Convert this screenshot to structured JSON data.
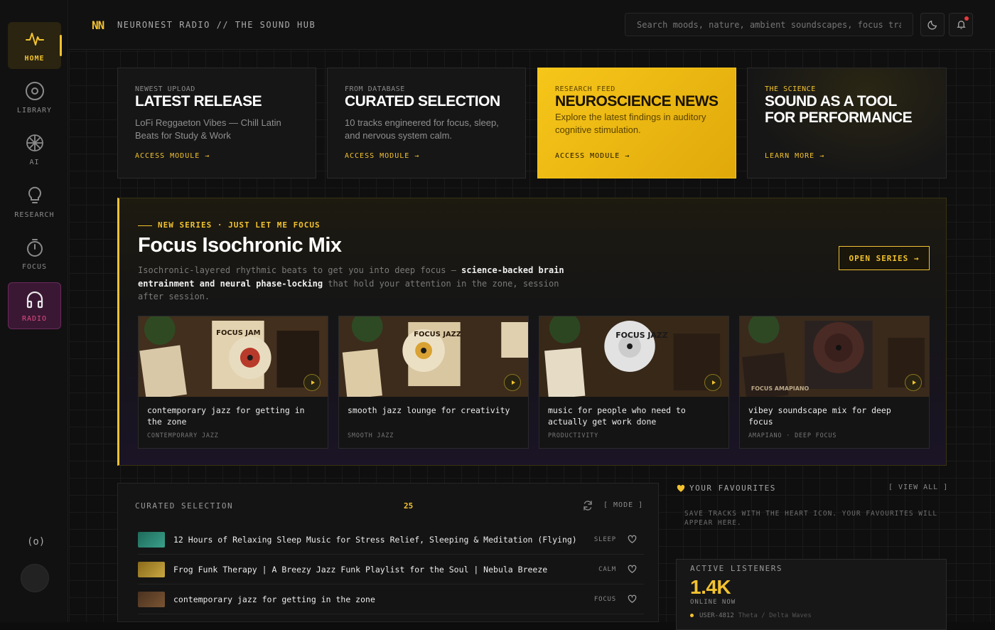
{
  "nav": {
    "home": "HOME",
    "library": "LIBRARY",
    "ai": "AI",
    "research": "RESEARCH",
    "focus": "FOCUS",
    "radio": "RADIO",
    "broadcast": "(o)"
  },
  "header": {
    "logo": "NN",
    "brand": "NEURONEST RADIO // THE SOUND HUB",
    "search_placeholder": "Search moods, nature, ambient soundscapes, focus tracks..."
  },
  "cards": [
    {
      "kicker": "NEWEST UPLOAD",
      "title": "LATEST RELEASE",
      "desc": "LoFi Reggaeton Vibes — Chill Latin Beats for Study & Work",
      "cta": "ACCESS MODULE →"
    },
    {
      "kicker": "FROM DATABASE",
      "title": "CURATED SELECTION",
      "desc": "10 tracks engineered for focus, sleep, and nervous system calm.",
      "cta": "ACCESS MODULE →"
    },
    {
      "kicker": "RESEARCH FEED",
      "title": "NEUROSCIENCE NEWS",
      "desc": "Explore the latest findings in auditory cognitive stimulation.",
      "cta": "ACCESS MODULE →"
    },
    {
      "kicker": "THE SCIENCE",
      "title": "SOUND AS A TOOL FOR PERFORMANCE",
      "desc": "",
      "cta": "LEARN MORE →"
    }
  ],
  "series": {
    "tag": "NEW SERIES · JUST LET ME FOCUS",
    "title": "Focus Isochronic Mix",
    "desc_pre": "Isochronic-layered rhythmic beats to get you into deep focus — ",
    "desc_bold": "science-backed brain entrainment and neural phase-locking",
    "desc_post": " that hold your attention in the zone, session after session.",
    "open_label": "OPEN SERIES →",
    "tracks": [
      {
        "title": "contemporary jazz for getting in the zone",
        "tag": "CONTEMPORARY JAZZ",
        "cover": "FOCUS JAM"
      },
      {
        "title": "smooth jazz lounge for creativity",
        "tag": "SMOOTH JAZZ",
        "cover": "FOCUS JAZZ"
      },
      {
        "title": "music for people who need to actually get work done",
        "tag": "PRODUCTIVITY",
        "cover": "FOCUS JAZZ"
      },
      {
        "title": "vibey soundscape mix for deep focus",
        "tag": "AMAPIANO · DEEP FOCUS",
        "cover": "FOCUS AMAPIANO"
      }
    ]
  },
  "curated": {
    "heading": "CURATED SELECTION",
    "count": "25",
    "mode_label": "[ MODE ]",
    "rows": [
      {
        "title": "12 Hours of Relaxing Sleep Music for Stress Relief, Sleeping & Meditation (Flying)",
        "tag": "SLEEP",
        "color": "#2a8a7a"
      },
      {
        "title": "Frog Funk Therapy | A Breezy Jazz Funk Playlist for the Soul | Nebula Breeze",
        "tag": "CALM",
        "color": "#b8952a"
      },
      {
        "title": "contemporary jazz for getting in the zone",
        "tag": "FOCUS",
        "color": "#6a4a2a"
      }
    ]
  },
  "favourites": {
    "heading": "YOUR FAVOURITES",
    "view_all": "[ VIEW ALL ]",
    "empty": "SAVE TRACKS WITH THE HEART ICON. YOUR FAVOURITES WILL APPEAR HERE."
  },
  "listeners": {
    "heading": "ACTIVE LISTENERS",
    "count": "1.4K",
    "sub": "ONLINE NOW",
    "user": "USER-4812",
    "wave": "Theta / Delta Waves"
  },
  "colors": {
    "accent": "#f2c230",
    "radio": "#e04a84",
    "bg": "#0f0f0f"
  }
}
